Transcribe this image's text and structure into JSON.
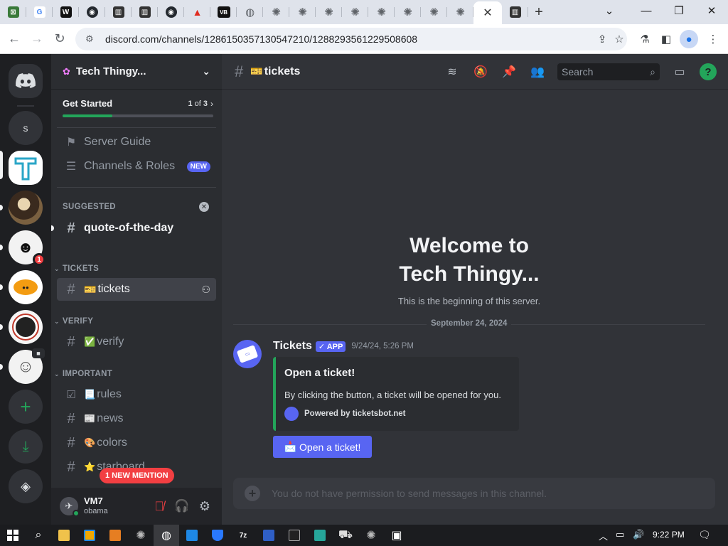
{
  "browser": {
    "url": "discord.com/channels/1286150357130547210/1288293561229508608",
    "tabs": [
      {
        "icon": "ebay-camera-icon",
        "color": "#3a7a3a",
        "glyph": "⊠"
      },
      {
        "icon": "google-icon",
        "color": "#ffffff",
        "glyph": "G"
      },
      {
        "icon": "w-site-icon",
        "color": "#111111",
        "glyph": "W"
      },
      {
        "icon": "github-icon",
        "color": "#24292f",
        "glyph": "◉"
      },
      {
        "icon": "museum-icon",
        "color": "#333333",
        "glyph": "▥"
      },
      {
        "icon": "museum-icon",
        "color": "#333333",
        "glyph": "▥"
      },
      {
        "icon": "github-icon",
        "color": "#24292f",
        "glyph": "◉"
      },
      {
        "icon": "warning-icon",
        "color": "#e02b20",
        "glyph": "▲"
      },
      {
        "icon": "vb-icon",
        "color": "#111111",
        "glyph": "VB"
      },
      {
        "icon": "globe-icon",
        "color": "#5f6368",
        "glyph": "◍"
      },
      {
        "icon": "chatgpt-icon",
        "color": "#5f6368",
        "glyph": "✺"
      },
      {
        "icon": "chatgpt-icon",
        "color": "#5f6368",
        "glyph": "✺"
      },
      {
        "icon": "chatgpt-icon",
        "color": "#5f6368",
        "glyph": "✺"
      },
      {
        "icon": "chatgpt-icon",
        "color": "#5f6368",
        "glyph": "✺"
      },
      {
        "icon": "chatgpt-icon",
        "color": "#5f6368",
        "glyph": "✺"
      },
      {
        "icon": "chatgpt-icon",
        "color": "#5f6368",
        "glyph": "✺"
      },
      {
        "icon": "chatgpt-icon",
        "color": "#5f6368",
        "glyph": "✺"
      },
      {
        "icon": "chatgpt-icon",
        "color": "#5f6368",
        "glyph": "✺"
      }
    ]
  },
  "server": {
    "name": "Tech Thingy...",
    "get_started": {
      "label": "Get Started",
      "progress_current": "1",
      "progress_of": "of",
      "progress_total": "3",
      "progress_fraction": 0.33
    },
    "guide": "Server Guide",
    "channels_roles": "Channels & Roles",
    "new_badge": "NEW",
    "suggested_label": "SUGGESTED",
    "suggested_channel": "quote-of-the-day",
    "categories": {
      "tickets": "TICKETS",
      "verify": "VERIFY",
      "important": "IMPORTANT"
    },
    "channels": {
      "tickets": "tickets",
      "tickets_emoji": "🎫",
      "verify": "verify",
      "verify_emoji": "✅",
      "rules": "rules",
      "rules_emoji": "📃",
      "news": "news",
      "news_emoji": "📰",
      "colors": "colors",
      "colors_emoji": "🎨",
      "starboard": "starboard",
      "starboard_emoji": "⭐"
    },
    "mention_badge": "1 NEW MENTION"
  },
  "guild_list": {
    "s_label": "s",
    "mention_count": "1"
  },
  "user": {
    "name": "VM7",
    "status": "obama"
  },
  "chat": {
    "channel_name": "tickets",
    "channel_emoji": "🎫",
    "search_placeholder": "Search",
    "welcome_line1": "Welcome to",
    "welcome_line2": "Tech Thingy...",
    "welcome_sub": "This is the beginning of this server.",
    "date_divider": "September 24, 2024",
    "message": {
      "author": "Tickets",
      "app_badge": "✓ APP",
      "timestamp": "9/24/24, 5:26 PM",
      "embed_title": "Open a ticket!",
      "embed_desc": "By clicking the button, a ticket will be opened for you.",
      "embed_footer": "Powered by ticketsbot.net",
      "button_label": "Open a ticket!",
      "button_emoji": "📩"
    },
    "composer_placeholder": "You do not have permission to send messages in this channel."
  },
  "taskbar": {
    "time": "9:22 PM"
  },
  "colors": {
    "blurple": "#5865f2",
    "green": "#23a55a",
    "red": "#f23f42"
  }
}
